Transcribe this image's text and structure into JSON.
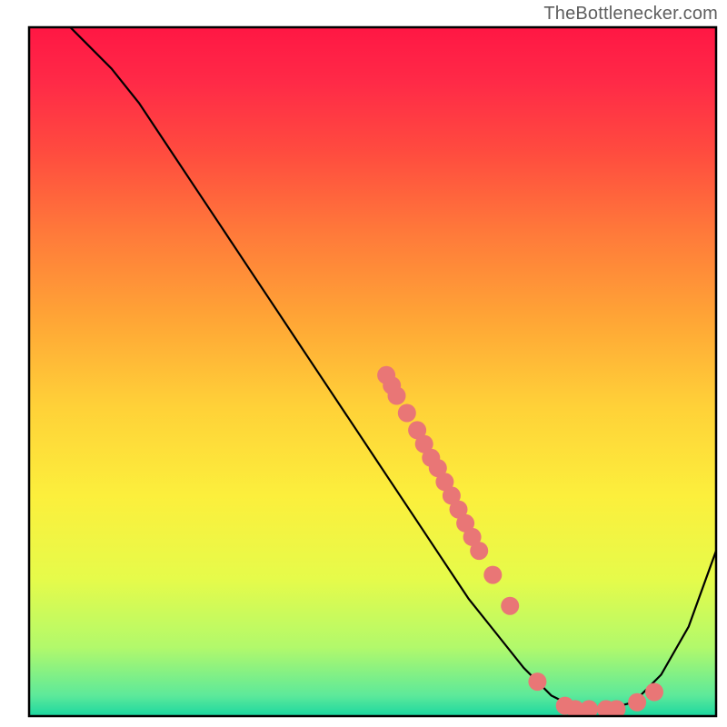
{
  "watermark": "TheBottlenecker.com",
  "chart_data": {
    "type": "line",
    "title": "",
    "xlabel": "",
    "ylabel": "",
    "xlim": [
      0,
      100
    ],
    "ylim": [
      0,
      100
    ],
    "grid": false,
    "series": [
      {
        "name": "curve",
        "x": [
          0,
          4,
          8,
          12,
          16,
          20,
          24,
          28,
          32,
          36,
          40,
          44,
          48,
          52,
          56,
          60,
          64,
          68,
          72,
          76,
          80,
          84,
          88,
          92,
          96,
          100
        ],
        "y": [
          106,
          102,
          98,
          94,
          89,
          83,
          77,
          71,
          65,
          59,
          53,
          47,
          41,
          35,
          29,
          23,
          17,
          12,
          7,
          3,
          1,
          1,
          2,
          6,
          13,
          24
        ]
      }
    ],
    "markers": [
      {
        "x": 52.0,
        "y": 49.5
      },
      {
        "x": 52.8,
        "y": 48.0
      },
      {
        "x": 53.5,
        "y": 46.5
      },
      {
        "x": 55.0,
        "y": 44.0
      },
      {
        "x": 56.5,
        "y": 41.5
      },
      {
        "x": 57.5,
        "y": 39.5
      },
      {
        "x": 58.5,
        "y": 37.5
      },
      {
        "x": 59.5,
        "y": 36.0
      },
      {
        "x": 60.5,
        "y": 34.0
      },
      {
        "x": 61.5,
        "y": 32.0
      },
      {
        "x": 62.5,
        "y": 30.0
      },
      {
        "x": 63.5,
        "y": 28.0
      },
      {
        "x": 64.5,
        "y": 26.0
      },
      {
        "x": 65.5,
        "y": 24.0
      },
      {
        "x": 67.5,
        "y": 20.5
      },
      {
        "x": 70.0,
        "y": 16.0
      },
      {
        "x": 74.0,
        "y": 5.0
      },
      {
        "x": 78.0,
        "y": 1.5
      },
      {
        "x": 79.5,
        "y": 1.0
      },
      {
        "x": 81.5,
        "y": 1.0
      },
      {
        "x": 84.0,
        "y": 1.0
      },
      {
        "x": 85.5,
        "y": 1.0
      },
      {
        "x": 88.5,
        "y": 2.0
      },
      {
        "x": 91.0,
        "y": 3.5
      }
    ],
    "gradient_stops": [
      {
        "offset": 0.0,
        "color": "#ff1744"
      },
      {
        "offset": 0.08,
        "color": "#ff2a47"
      },
      {
        "offset": 0.18,
        "color": "#ff4b3f"
      },
      {
        "offset": 0.3,
        "color": "#ff7a3a"
      },
      {
        "offset": 0.42,
        "color": "#ffa436"
      },
      {
        "offset": 0.55,
        "color": "#ffd138"
      },
      {
        "offset": 0.68,
        "color": "#fcef3c"
      },
      {
        "offset": 0.8,
        "color": "#e6fb4a"
      },
      {
        "offset": 0.9,
        "color": "#b2f96b"
      },
      {
        "offset": 0.97,
        "color": "#5de99a"
      },
      {
        "offset": 1.0,
        "color": "#1bd7a0"
      }
    ],
    "frame_color": "#000000",
    "curve_color": "#000000",
    "marker_color": "#e97676",
    "marker_radius": 10
  }
}
